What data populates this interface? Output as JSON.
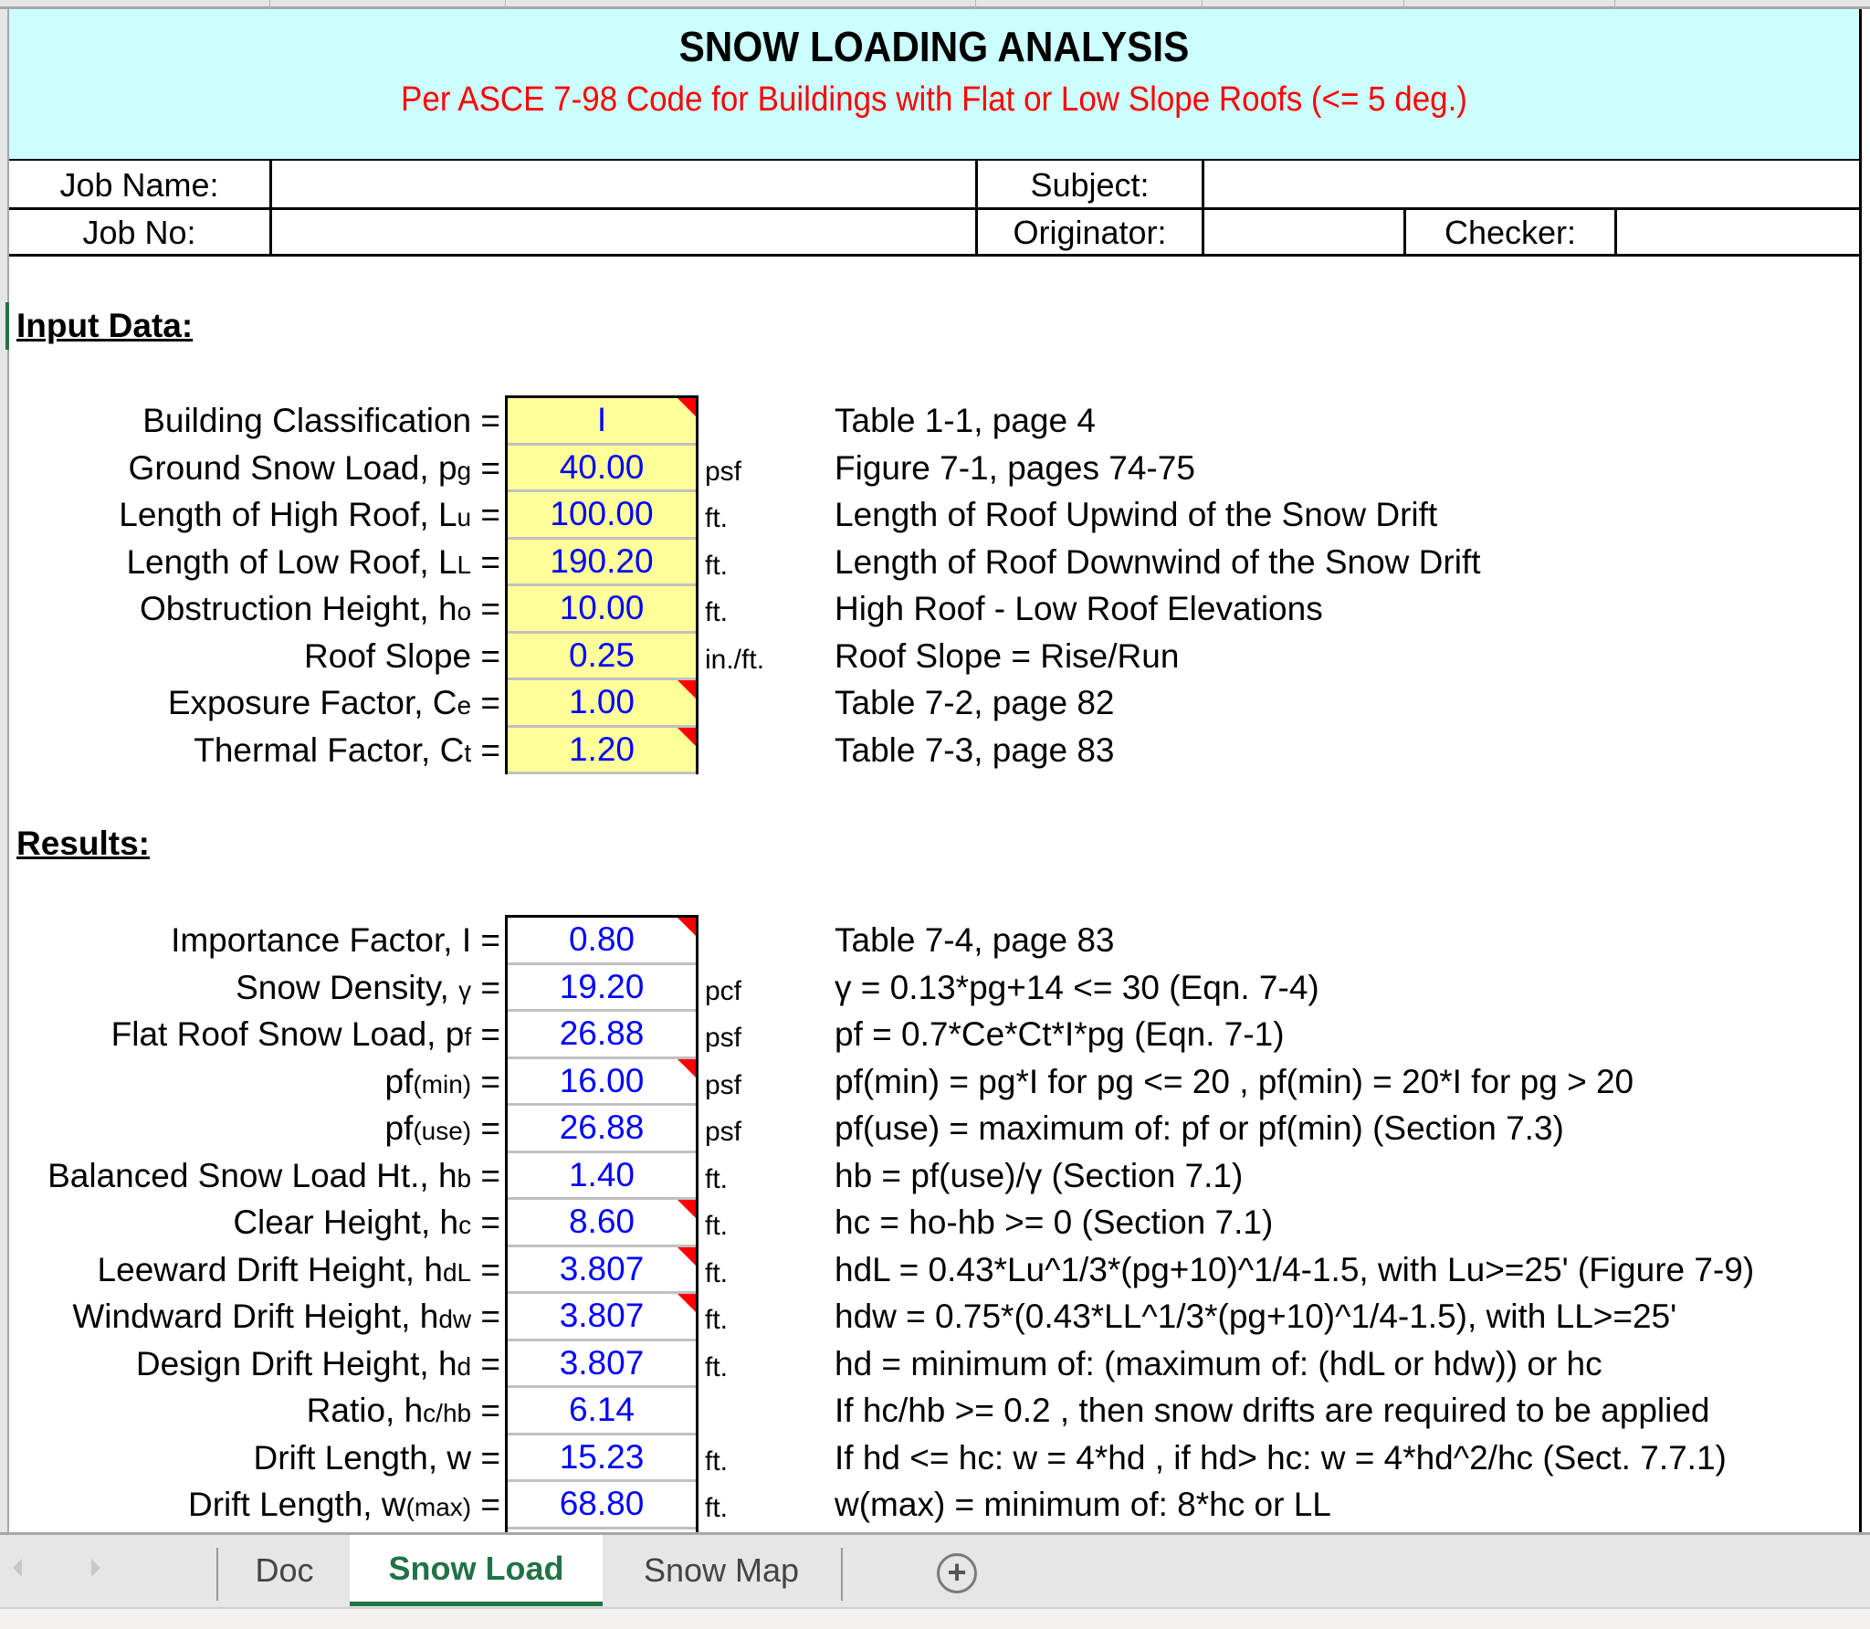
{
  "sheet": {
    "title": "SNOW LOADING ANALYSIS",
    "subtitle": "Per ASCE 7-98 Code for Buildings with Flat or Low Slope Roofs (<= 5 deg.)",
    "title_color": "#000000",
    "subtitle_color": "#ff0000",
    "header_bg": "#ccffff"
  },
  "job_info": {
    "job_name_label": "Job Name:",
    "job_name_value": "",
    "subject_label": "Subject:",
    "subject_value": "",
    "job_no_label": "Job No:",
    "job_no_value": "",
    "originator_label": "Originator:",
    "originator_value": "",
    "checker_label": "Checker:",
    "checker_value": ""
  },
  "input_section": {
    "heading": "Input Data:",
    "rows": [
      {
        "label": "Building Classification =",
        "label_main": "Building Classification",
        "sub": "",
        "value": "I",
        "unit": "",
        "ref": "Table 1-1, page 4",
        "comment": true
      },
      {
        "label_main": "Ground Snow Load, p",
        "sub": "g",
        "value": "40.00",
        "unit": "psf",
        "ref": "Figure 7-1, pages 74-75",
        "comment": false
      },
      {
        "label_main": "Length of High Roof, L",
        "sub": "u",
        "value": "100.00",
        "unit": "ft.",
        "ref": "Length of Roof Upwind of the Snow Drift",
        "comment": false
      },
      {
        "label_main": "Length of Low Roof, L",
        "sub": "L",
        "value": "190.20",
        "unit": "ft.",
        "ref": "Length of Roof Downwind of the Snow Drift",
        "comment": false
      },
      {
        "label_main": "Obstruction Height, h",
        "sub": "o",
        "value": "10.00",
        "unit": "ft.",
        "ref": "High Roof - Low Roof Elevations",
        "comment": false
      },
      {
        "label_main": "Roof Slope",
        "sub": "",
        "value": "0.25",
        "unit": "in./ft.",
        "ref": "Roof Slope = Rise/Run",
        "comment": false
      },
      {
        "label_main": "Exposure Factor, C",
        "sub": "e",
        "value": "1.00",
        "unit": "",
        "ref": "Table 7-2, page 82",
        "comment": true
      },
      {
        "label_main": "Thermal Factor, C",
        "sub": "t",
        "value": "1.20",
        "unit": "",
        "ref": "Table 7-3, page 83",
        "comment": true
      }
    ]
  },
  "results_section": {
    "heading": "Results:",
    "rows": [
      {
        "label_main": "Importance Factor, I",
        "sub": "",
        "value": "0.80",
        "unit": "",
        "ref": "Table 7-4, page 83",
        "comment": true
      },
      {
        "label_main": "Snow Density, ",
        "sub": "γ",
        "value": "19.20",
        "unit": "pcf",
        "ref": "γ = 0.13*pg+14 <= 30  (Eqn. 7-4)",
        "comment": false
      },
      {
        "label_main": "Flat Roof Snow Load, p",
        "sub": "f",
        "value": "26.88",
        "unit": "psf",
        "ref": "pf = 0.7*Ce*Ct*I*pg  (Eqn. 7-1)",
        "comment": false
      },
      {
        "label_main": "pf",
        "sub": "(min)",
        "value": "16.00",
        "unit": "psf",
        "ref": "pf(min) = pg*I  for pg <= 20 ,  pf(min) = 20*I  for pg > 20",
        "comment": true
      },
      {
        "label_main": "pf",
        "sub": "(use)",
        "value": "26.88",
        "unit": "psf",
        "ref": "pf(use) = maximum of: pf  or  pf(min)  (Section 7.3)",
        "comment": false
      },
      {
        "label_main": "Balanced Snow Load Ht., h",
        "sub": "b",
        "value": "1.40",
        "unit": "ft.",
        "ref": "hb = pf(use)/γ  (Section 7.1)",
        "comment": false
      },
      {
        "label_main": "Clear Height, h",
        "sub": "c",
        "value": "8.60",
        "unit": "ft.",
        "ref": "hc = ho-hb >= 0  (Section 7.1)",
        "comment": true
      },
      {
        "label_main": "Leeward Drift Height, h",
        "sub": "dL",
        "value": "3.807",
        "unit": "ft.",
        "ref": "hdL = 0.43*Lu^1/3*(pg+10)^1/4-1.5,  with Lu>=25'  (Figure 7-9)",
        "comment": true
      },
      {
        "label_main": "Windward Drift Height, h",
        "sub": "dw",
        "value": "3.807",
        "unit": "ft.",
        "ref": "hdw = 0.75*(0.43*LL^1/3*(pg+10)^1/4-1.5), with LL>=25'",
        "comment": true
      },
      {
        "label_main": "Design Drift Height, h",
        "sub": "d",
        "value": "3.807",
        "unit": "ft.",
        "ref": "hd = minimum of: (maximum of: (hdL  or  hdw))  or  hc",
        "comment": false
      },
      {
        "label_main": "Ratio, h",
        "sub": "c/hb",
        "value": "6.14",
        "unit": "",
        "ref": "If hc/hb >= 0.2 , then snow drifts are required to be applied",
        "comment": false
      },
      {
        "label_main": "Drift Length, w",
        "sub": "",
        "value": "15.23",
        "unit": "ft.",
        "ref": "If hd <= hc:  w = 4*hd ,  if hd> hc:  w = 4*hd^2/hc  (Sect. 7.7.1)",
        "comment": false
      },
      {
        "label_main": "Drift Length, w",
        "sub": "(max)",
        "value": "68.80",
        "unit": "ft.",
        "ref": "w(max) = minimum of:  8*hc  or  LL",
        "comment": false
      }
    ]
  },
  "tabs": {
    "items": [
      {
        "label": "Doc",
        "active": false
      },
      {
        "label": "Snow Load",
        "active": true
      },
      {
        "label": "Snow Map",
        "active": false
      }
    ],
    "add_sheet_symbol": "+",
    "prev_icon": "chevron-left-icon",
    "next_icon": "chevron-right-icon",
    "active_color": "#217346"
  },
  "colors": {
    "input_fill": "#ffff99",
    "value_text": "#0000ff",
    "comment_marker": "#ff0000"
  }
}
